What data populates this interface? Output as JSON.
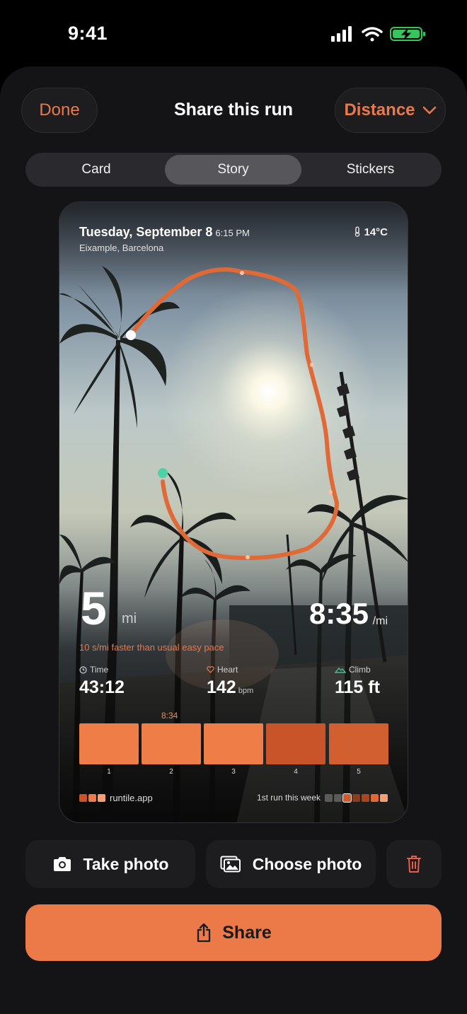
{
  "status": {
    "time": "9:41"
  },
  "header": {
    "done_label": "Done",
    "title": "Share this run",
    "metric_label": "Distance"
  },
  "tabs": [
    {
      "label": "Card",
      "active": false
    },
    {
      "label": "Story",
      "active": true
    },
    {
      "label": "Stickers",
      "active": false
    }
  ],
  "card": {
    "date": "Tuesday, September 8",
    "time": "6:15 PM",
    "location": "Eixample, Barcelona",
    "temperature": "14°C",
    "distance": {
      "value": "5",
      "unit": "mi"
    },
    "pace": {
      "value": "8:35",
      "unit": "/mi"
    },
    "note": "10 s/mi faster than usual easy pace",
    "stats": [
      {
        "icon": "clock-icon",
        "label": "Time",
        "value": "43:12",
        "unit": ""
      },
      {
        "icon": "heart-icon",
        "label": "Heart",
        "value": "142",
        "unit": "bpm"
      },
      {
        "icon": "mountain-icon",
        "label": "Climb",
        "value": "115 ft",
        "unit": ""
      }
    ],
    "best_split_label": "8:34",
    "splits": [
      {
        "num": "1",
        "color": "#ee7d48"
      },
      {
        "num": "2",
        "color": "#ee7d48"
      },
      {
        "num": "3",
        "color": "#ee7d48"
      },
      {
        "num": "4",
        "color": "#c9542a"
      },
      {
        "num": "5",
        "color": "#d25f2f"
      }
    ],
    "brand": "runtile.app",
    "week_label": "1st run this week",
    "week_colors": [
      "#5a5a5a",
      "#5a5a5a",
      "#d05a2b",
      "#8a3d1e",
      "#a8461f",
      "#e06a37",
      "#f3a074"
    ]
  },
  "actions": {
    "take_photo": "Take photo",
    "choose_photo": "Choose photo",
    "share": "Share"
  },
  "colors": {
    "accent": "#ec7a48",
    "route": "#e06a37",
    "start": "#4fd1a5"
  }
}
